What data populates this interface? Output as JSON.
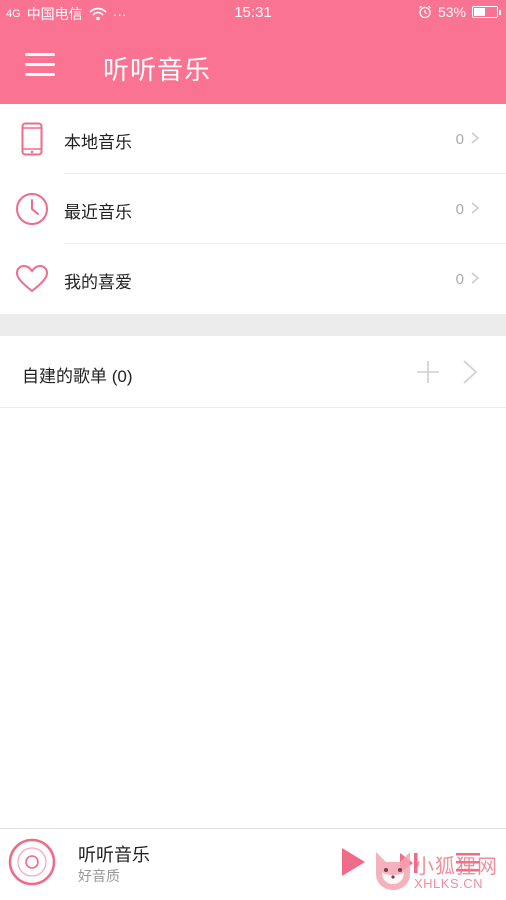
{
  "status_bar": {
    "signal": "4G",
    "carrier": "中国电信",
    "dots": "···",
    "time": "15:31",
    "alarm_icon": "alarm-clock-icon",
    "battery_percent": "53%",
    "battery_level": 0.53
  },
  "header": {
    "title": "听听音乐",
    "menu_icon": "hamburger-menu-icon",
    "background_color": "#fb7393"
  },
  "library": [
    {
      "label": "本地音乐",
      "count": "0",
      "icon": "phone-icon"
    },
    {
      "label": "最近音乐",
      "count": "0",
      "icon": "clock-icon"
    },
    {
      "label": "我的喜爱",
      "count": "0",
      "icon": "heart-icon"
    }
  ],
  "playlists": {
    "title": "自建的歌单 (0)",
    "add_icon": "plus-icon",
    "open_icon": "chevron-right-icon"
  },
  "player": {
    "title": "听听音乐",
    "subtitle": "好音质",
    "accent_color": "#f06a8a"
  },
  "watermark": {
    "cn": "小狐狸网",
    "en": "XHLKS.CN"
  }
}
